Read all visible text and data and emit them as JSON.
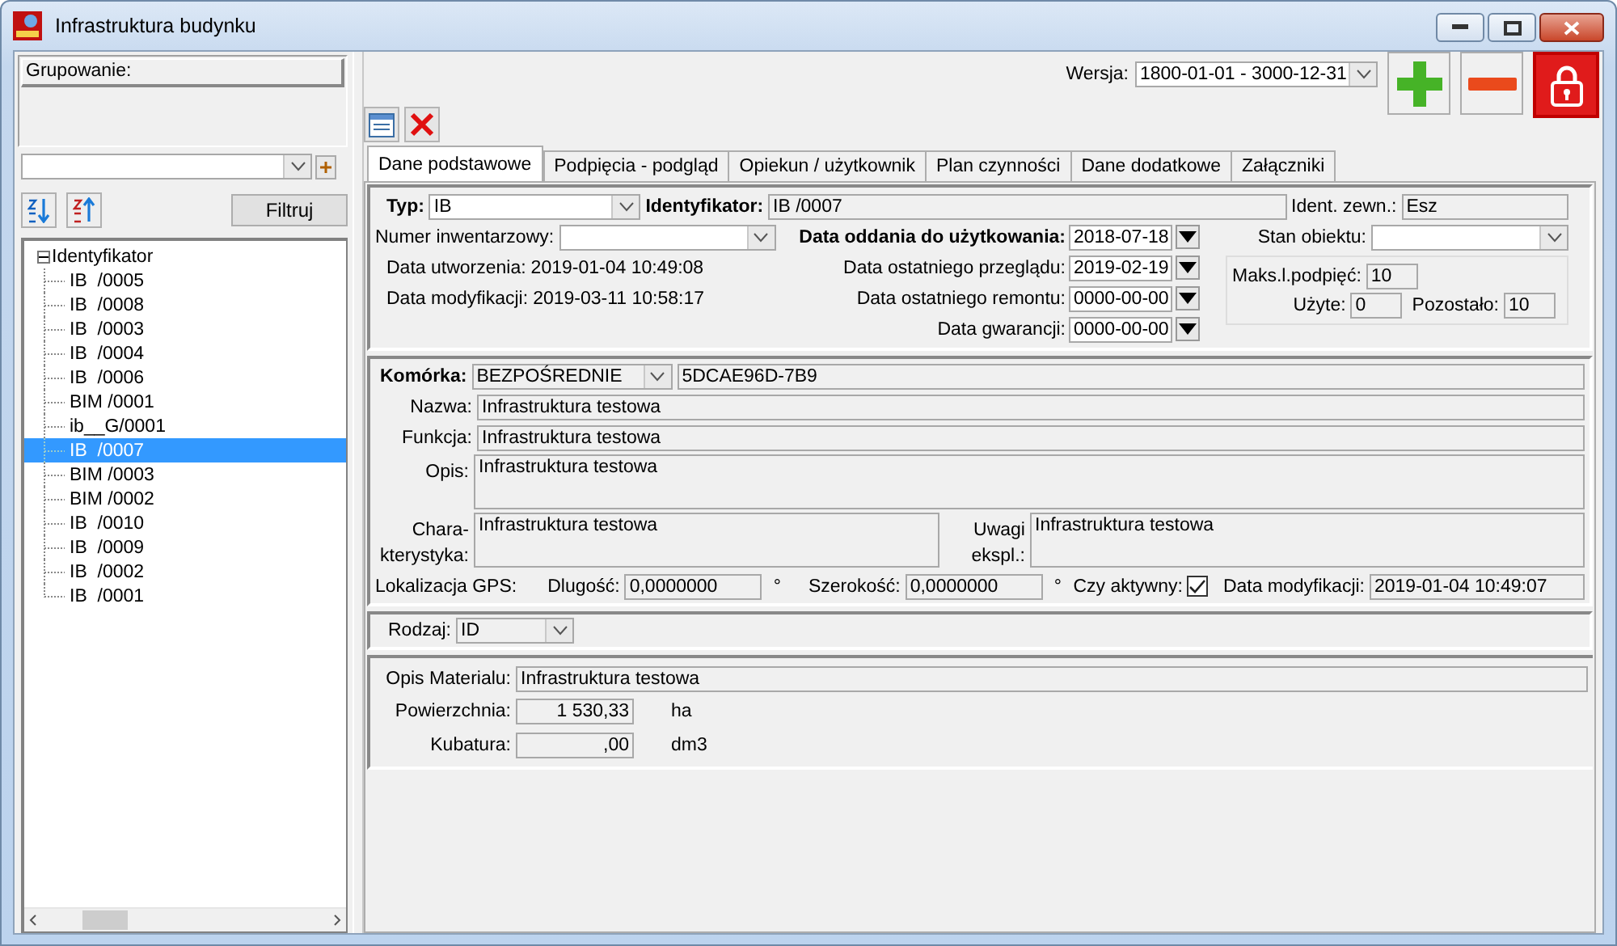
{
  "window": {
    "title": "Infrastruktura budynku"
  },
  "sidebar": {
    "grouping_label": "Grupowanie:",
    "filter_button": "Filtruj",
    "tree": {
      "label": "Identyfikator",
      "expanded": true,
      "children": [
        {
          "label": "IB  /0005",
          "selected": false
        },
        {
          "label": "IB  /0008",
          "selected": false
        },
        {
          "label": "IB  /0003",
          "selected": false
        },
        {
          "label": "IB  /0004",
          "selected": false
        },
        {
          "label": "IB  /0006",
          "selected": false
        },
        {
          "label": "BIM /0001",
          "selected": false
        },
        {
          "label": "ib__G/0001",
          "selected": false
        },
        {
          "label": "IB  /0007",
          "selected": true
        },
        {
          "label": "BIM /0003",
          "selected": false
        },
        {
          "label": "BIM /0002",
          "selected": false
        },
        {
          "label": "IB  /0010",
          "selected": false
        },
        {
          "label": "IB  /0009",
          "selected": false
        },
        {
          "label": "IB  /0002",
          "selected": false
        },
        {
          "label": "IB  /0001",
          "selected": false
        }
      ]
    }
  },
  "toolbar": {
    "version_label": "Wersja:",
    "version_value": "1800-01-01 - 3000-12-31"
  },
  "tabs": [
    {
      "label": "Dane podstawowe",
      "selected": true
    },
    {
      "label": "Podpięcia - podgląd",
      "selected": false
    },
    {
      "label": "Opiekun / użytkownik",
      "selected": false
    },
    {
      "label": "Plan czynności",
      "selected": false
    },
    {
      "label": "Dane dodatkowe",
      "selected": false
    },
    {
      "label": "Załączniki",
      "selected": false
    }
  ],
  "general": {
    "type_label": "Typ:",
    "type_value": "IB",
    "identifier_label": "Identyfikator:",
    "identifier_value": "IB  /0007",
    "ext_id_label": "Ident. zewn.:",
    "ext_id_value": "Esz",
    "inventory_label": "Numer inwentarzowy:",
    "created_label": "Data utworzenia:",
    "created_value": "2019-01-04 10:49:08",
    "modified_label": "Data modyfikacji:",
    "modified_value": "2019-03-11 10:58:17",
    "dates": [
      {
        "label": "Data oddania do użytkowania:",
        "value": "2018-07-18",
        "bold": true
      },
      {
        "label": "Data ostatniego przeglądu:",
        "value": "2019-02-19",
        "bold": false
      },
      {
        "label": "Data ostatniego remontu:",
        "value": "0000-00-00",
        "bold": false
      },
      {
        "label": "Data gwarancji:",
        "value": "0000-00-00",
        "bold": false
      }
    ],
    "status_label": "Stan obiektu:",
    "limits": {
      "max_label": "Maks.l.podpięć:",
      "max_value": "10",
      "used_label": "Użyte:",
      "used_value": "0",
      "left_label": "Pozostało:",
      "left_value": "10"
    }
  },
  "cell": {
    "label": "Komórka:",
    "mode": "BEZPOŚREDNIE",
    "code": "5DCAE96D-7B9",
    "fields": [
      {
        "label": "Nazwa:",
        "value": "Infrastruktura testowa",
        "kind": "line"
      },
      {
        "label": "Funkcja:",
        "value": "Infrastruktura testowa",
        "kind": "line"
      },
      {
        "label": "Opis:",
        "value": "Infrastruktura testowa",
        "kind": "area"
      }
    ],
    "characteristics_label": "Chara- kterystyka:",
    "characteristics_value": "Infrastruktura testowa",
    "remarks_label": "Uwagi ekspl.:",
    "remarks_value": "Infrastruktura testowa",
    "gps_label": "Lokalizacja GPS:",
    "longitude_label": "Dlugość:",
    "longitude_value": "0,0000000",
    "longitude_unit": "°",
    "latitude_label": "Szerokość:",
    "latitude_value": "0,0000000",
    "latitude_unit": "°",
    "active_label": "Czy aktywny:",
    "active": true,
    "modified_label": "Data modyfikacji:",
    "modified_value": "2019-01-04 10:49:07"
  },
  "kind_row": {
    "label": "Rodzaj:",
    "value": "ID"
  },
  "material": {
    "description_label": "Opis Materialu:",
    "description_value": "Infrastruktura testowa",
    "measures": [
      {
        "label": "Powierzchnia:",
        "value": "1 530,33",
        "unit": "ha"
      },
      {
        "label": "Kubatura:",
        "value": ",00",
        "unit": "dm3"
      }
    ]
  }
}
